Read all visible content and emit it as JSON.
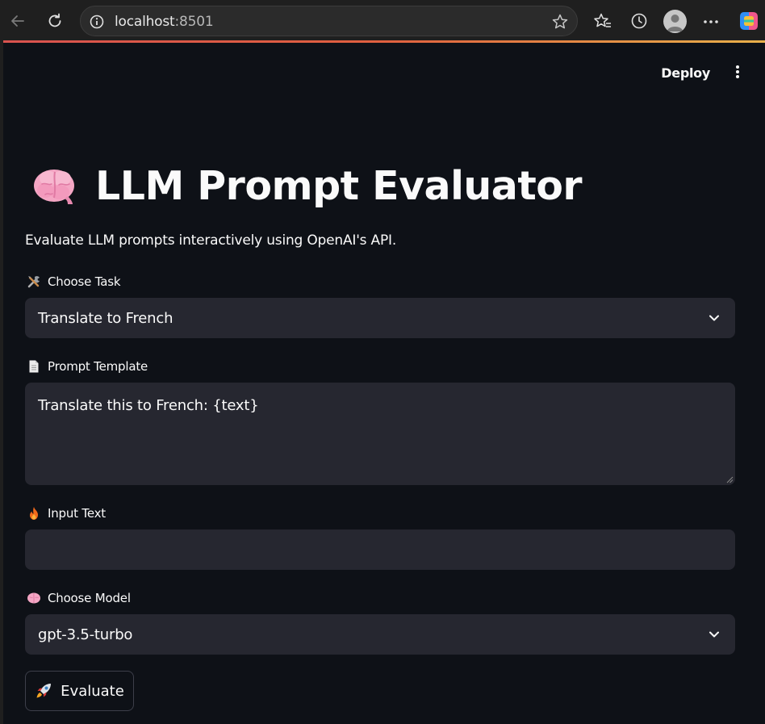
{
  "browser": {
    "url_host": "localhost",
    "url_port": ":8501"
  },
  "header": {
    "deploy_label": "Deploy"
  },
  "page": {
    "title": "LLM Prompt Evaluator",
    "subtitle": "Evaluate LLM prompts interactively using OpenAI's API."
  },
  "form": {
    "task": {
      "label": "Choose Task",
      "icon": "tools-icon",
      "value": "Translate to French"
    },
    "template": {
      "label": "Prompt Template",
      "icon": "document-icon",
      "value": "Translate this to French: {text}"
    },
    "input": {
      "label": "Input Text",
      "icon": "fire-icon",
      "value": ""
    },
    "model": {
      "label": "Choose Model",
      "icon": "brain-icon",
      "value": "gpt-3.5-turbo"
    },
    "evaluate_label": "Evaluate"
  },
  "colors": {
    "app_bg": "#0e1117",
    "widget_bg": "#262730",
    "text": "#fafafa"
  }
}
